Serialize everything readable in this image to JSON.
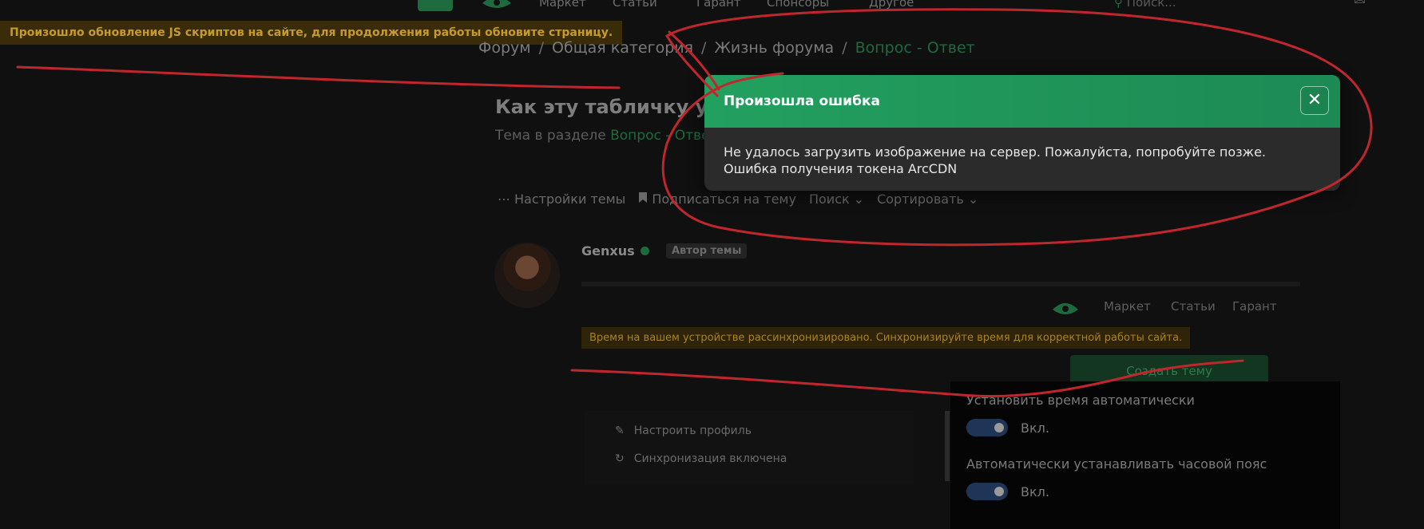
{
  "topnav": {
    "links": [
      "Маркет",
      "Статьи",
      "Гарант",
      "Спонсоры",
      "Другое"
    ],
    "search_placeholder": "Поиск..."
  },
  "notice_js": "Произошло обновление JS скриптов на сайте, для продолжения работы обновите страницу.",
  "breadcrumb": {
    "items": [
      "Форум",
      "Общая категория",
      "Жизнь форума"
    ],
    "current": "Вопрос - Ответ"
  },
  "thread": {
    "title": "Как эту табличку убр",
    "subtitle_prefix": "Тема в разделе",
    "subtitle_link": "Вопрос - Ответ"
  },
  "toolbar": {
    "settings": "Настройки темы",
    "subscribe": "Подписаться на тему",
    "search": "Поиск",
    "sort": "Сортировать"
  },
  "post": {
    "author": "Genxus",
    "badge": "Автор темы",
    "inner_nav": [
      "Маркет",
      "Статьи",
      "Гарант"
    ],
    "notice_time": "Время на вашем устройстве рассинхронизировано. Синхронизируйте время для корректной работы сайта.",
    "create_button": "Создать тему",
    "menu": [
      "Настроить профиль",
      "Синхронизация включена"
    ],
    "settings": [
      {
        "label": "Установить время автоматически",
        "toggle": "Вкл."
      },
      {
        "label": "Автоматически устанавливать часовой пояс",
        "toggle": "Вкл."
      }
    ]
  },
  "dialog": {
    "title": "Произошла ошибка",
    "line1": "Не удалось загрузить изображение на сервер. Пожалуйста, попробуйте позже.",
    "line2": "Ошибка получения токена ArcCDN"
  },
  "colors": {
    "accent": "#22a05e",
    "scribble": "#c0262c",
    "notice": "#c59b2a"
  }
}
